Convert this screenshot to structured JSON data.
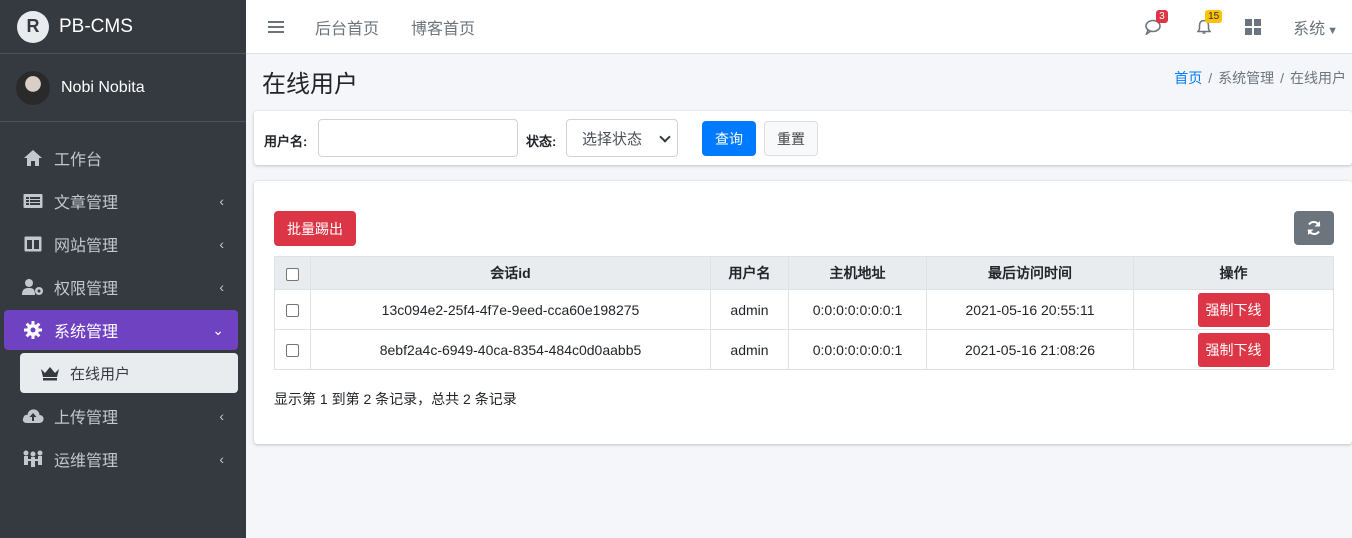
{
  "brand": {
    "name": "PB-CMS",
    "logo_letter": "R"
  },
  "user": {
    "name": "Nobi Nobita"
  },
  "sidebar": {
    "items": [
      {
        "label": "工作台",
        "icon": "home-icon"
      },
      {
        "label": "文章管理",
        "icon": "article-icon"
      },
      {
        "label": "网站管理",
        "icon": "website-icon"
      },
      {
        "label": "权限管理",
        "icon": "user-gear-icon"
      },
      {
        "label": "系统管理",
        "icon": "gear-icon"
      },
      {
        "label": "上传管理",
        "icon": "cloud-upload-icon"
      },
      {
        "label": "运维管理",
        "icon": "people-icon"
      }
    ],
    "sub_item": {
      "label": "在线用户",
      "icon": "chess-king-icon"
    }
  },
  "topbar": {
    "links": [
      "后台首页",
      "博客首页"
    ],
    "messages_count": "3",
    "notifications_count": "15",
    "system_menu": "系统"
  },
  "page": {
    "title": "在线用户",
    "breadcrumb": [
      "首页",
      "系统管理",
      "在线用户"
    ]
  },
  "search": {
    "username_label": "用户名:",
    "username_value": "",
    "status_label": "状态:",
    "status_selected": "选择状态",
    "query_button": "查询",
    "reset_button": "重置"
  },
  "toolbar": {
    "batch_kick_button": "批量踢出"
  },
  "table": {
    "columns": [
      "会话id",
      "用户名",
      "主机地址",
      "最后访问时间",
      "操作"
    ],
    "rows": [
      {
        "session_id": "13c094e2-25f4-4f7e-9eed-cca60e198275",
        "username": "admin",
        "host": "0:0:0:0:0:0:0:1",
        "last_access": "2021-05-16 20:55:11",
        "action": "强制下线"
      },
      {
        "session_id": "8ebf2a4c-6949-40ca-8354-484c0d0aabb5",
        "username": "admin",
        "host": "0:0:0:0:0:0:0:1",
        "last_access": "2021-05-16 21:08:26",
        "action": "强制下线"
      }
    ],
    "footer": "显示第 1 到第 2 条记录，总共 2 条记录"
  },
  "colors": {
    "sidebar_bg": "#343a40",
    "active": "#6f42c1",
    "primary": "#007bff",
    "danger": "#dc3545"
  }
}
